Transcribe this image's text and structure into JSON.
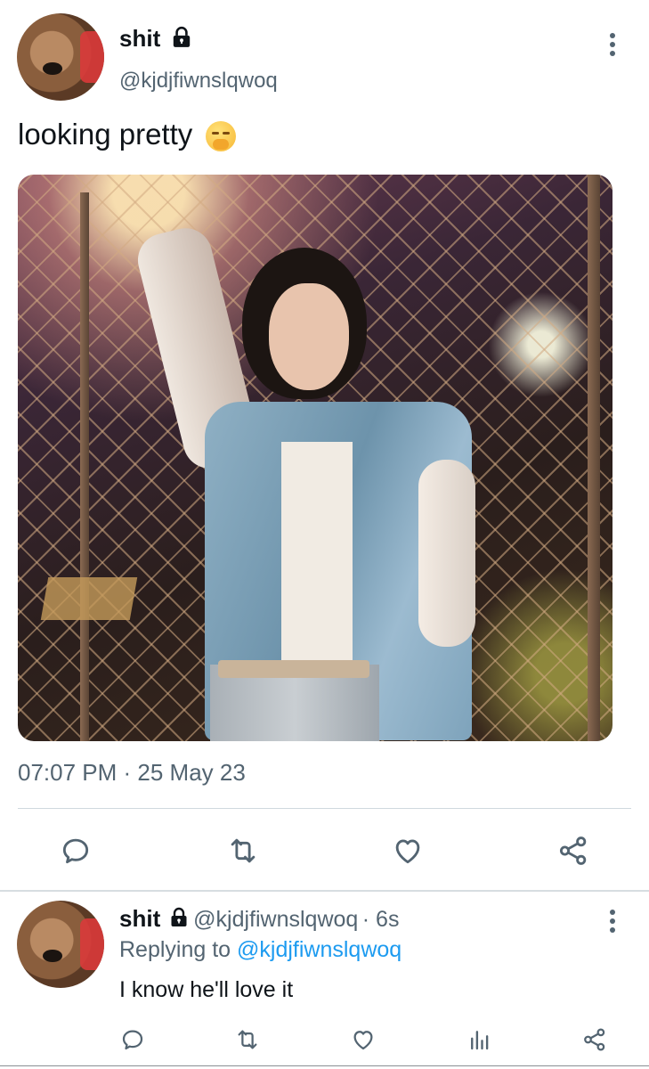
{
  "tweet": {
    "author_name": "shit",
    "author_handle": "@kjdjfiwnslqwoq",
    "text": "looking pretty",
    "emoji": "🤭",
    "timestamp": "07:07 PM · 25 May 23"
  },
  "reply": {
    "author_name": "shit",
    "author_handle": "@kjdjfiwnslqwoq",
    "time_ago": "· 6s",
    "replying_prefix": "Replying to",
    "replying_handle": "@kjdjfiwnslqwoq",
    "text": "I know he'll love it"
  },
  "icons": {
    "lock": "lock-icon",
    "more": "more-vertical-icon",
    "reply": "comment-icon",
    "retweet": "retweet-icon",
    "like": "heart-icon",
    "share": "share-icon",
    "views": "analytics-icon"
  },
  "colors": {
    "text_primary": "#0f1419",
    "text_secondary": "#536471",
    "link": "#1d9bf0",
    "divider": "#cfd9de"
  }
}
